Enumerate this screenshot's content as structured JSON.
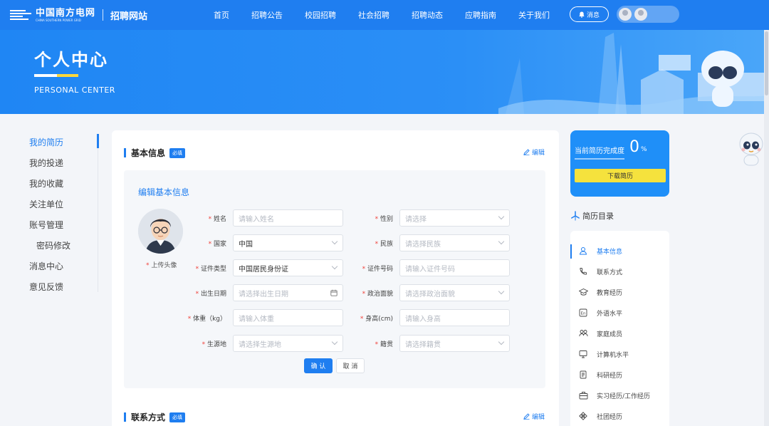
{
  "header": {
    "logo_name": "中国南方电网",
    "logo_sub": "CHINA SOUTHERN POWER GRID",
    "site_name": "招聘网站",
    "nav": [
      "首页",
      "招聘公告",
      "校园招聘",
      "社会招聘",
      "招聘动态",
      "应聘指南",
      "关于我们"
    ],
    "message_label": "消息"
  },
  "banner": {
    "title": "个人中心",
    "subtitle": "PERSONAL CENTER"
  },
  "sidebar": {
    "items": [
      {
        "label": "我的简历",
        "active": true
      },
      {
        "label": "我的投递"
      },
      {
        "label": "我的收藏"
      },
      {
        "label": "关注单位"
      },
      {
        "label": "账号管理"
      },
      {
        "label": "密码修改"
      },
      {
        "label": "消息中心"
      },
      {
        "label": "意见反馈"
      }
    ]
  },
  "basic_info": {
    "title": "基本信息",
    "badge": "必填",
    "edit_label": "编辑",
    "form_title": "编辑基本信息",
    "avatar_caption": "上传头像",
    "fields": {
      "name": {
        "label": "姓名",
        "placeholder": "请输入姓名"
      },
      "gender": {
        "label": "性别",
        "placeholder": "请选择"
      },
      "country": {
        "label": "国家",
        "value": "中国"
      },
      "ethnicity": {
        "label": "民族",
        "placeholder": "请选择民族"
      },
      "id_type": {
        "label": "证件类型",
        "value": "中国居民身份证"
      },
      "id_number": {
        "label": "证件号码",
        "placeholder": "请输入证件号码"
      },
      "birth_date": {
        "label": "出生日期",
        "placeholder": "请选择出生日期"
      },
      "political": {
        "label": "政治面貌",
        "placeholder": "请选择政治面貌"
      },
      "weight": {
        "label": "体重（kg）",
        "placeholder": "请输入体重"
      },
      "height": {
        "label": "身高(cm)",
        "placeholder": "请输入身高"
      },
      "origin": {
        "label": "生源地",
        "placeholder": "请选择生源地"
      },
      "native": {
        "label": "籍贯",
        "placeholder": "请选择籍贯"
      }
    },
    "confirm_label": "确 认",
    "cancel_label": "取 消"
  },
  "contact": {
    "title": "联系方式",
    "badge": "必填",
    "edit_label": "编辑"
  },
  "progress": {
    "label": "当前简历完成度",
    "value": "0",
    "unit": "%",
    "fraction": 0,
    "download_label": "下载简历"
  },
  "directory": {
    "title": "简历目录",
    "items": [
      {
        "label": "基本信息",
        "icon": "person-icon",
        "active": true
      },
      {
        "label": "联系方式",
        "icon": "phone-icon"
      },
      {
        "label": "教育经历",
        "icon": "graduation-cap-icon"
      },
      {
        "label": "外语水平",
        "icon": "language-icon"
      },
      {
        "label": "家庭成员",
        "icon": "family-icon"
      },
      {
        "label": "计算机水平",
        "icon": "monitor-icon"
      },
      {
        "label": "科研经历",
        "icon": "research-doc-icon"
      },
      {
        "label": "实习经历/工作经历",
        "icon": "briefcase-icon"
      },
      {
        "label": "社团经历",
        "icon": "club-icon"
      }
    ]
  },
  "colors": {
    "primary": "#1f7ef0",
    "accent_yellow": "#f5e23d",
    "required_red": "#f0433b"
  }
}
